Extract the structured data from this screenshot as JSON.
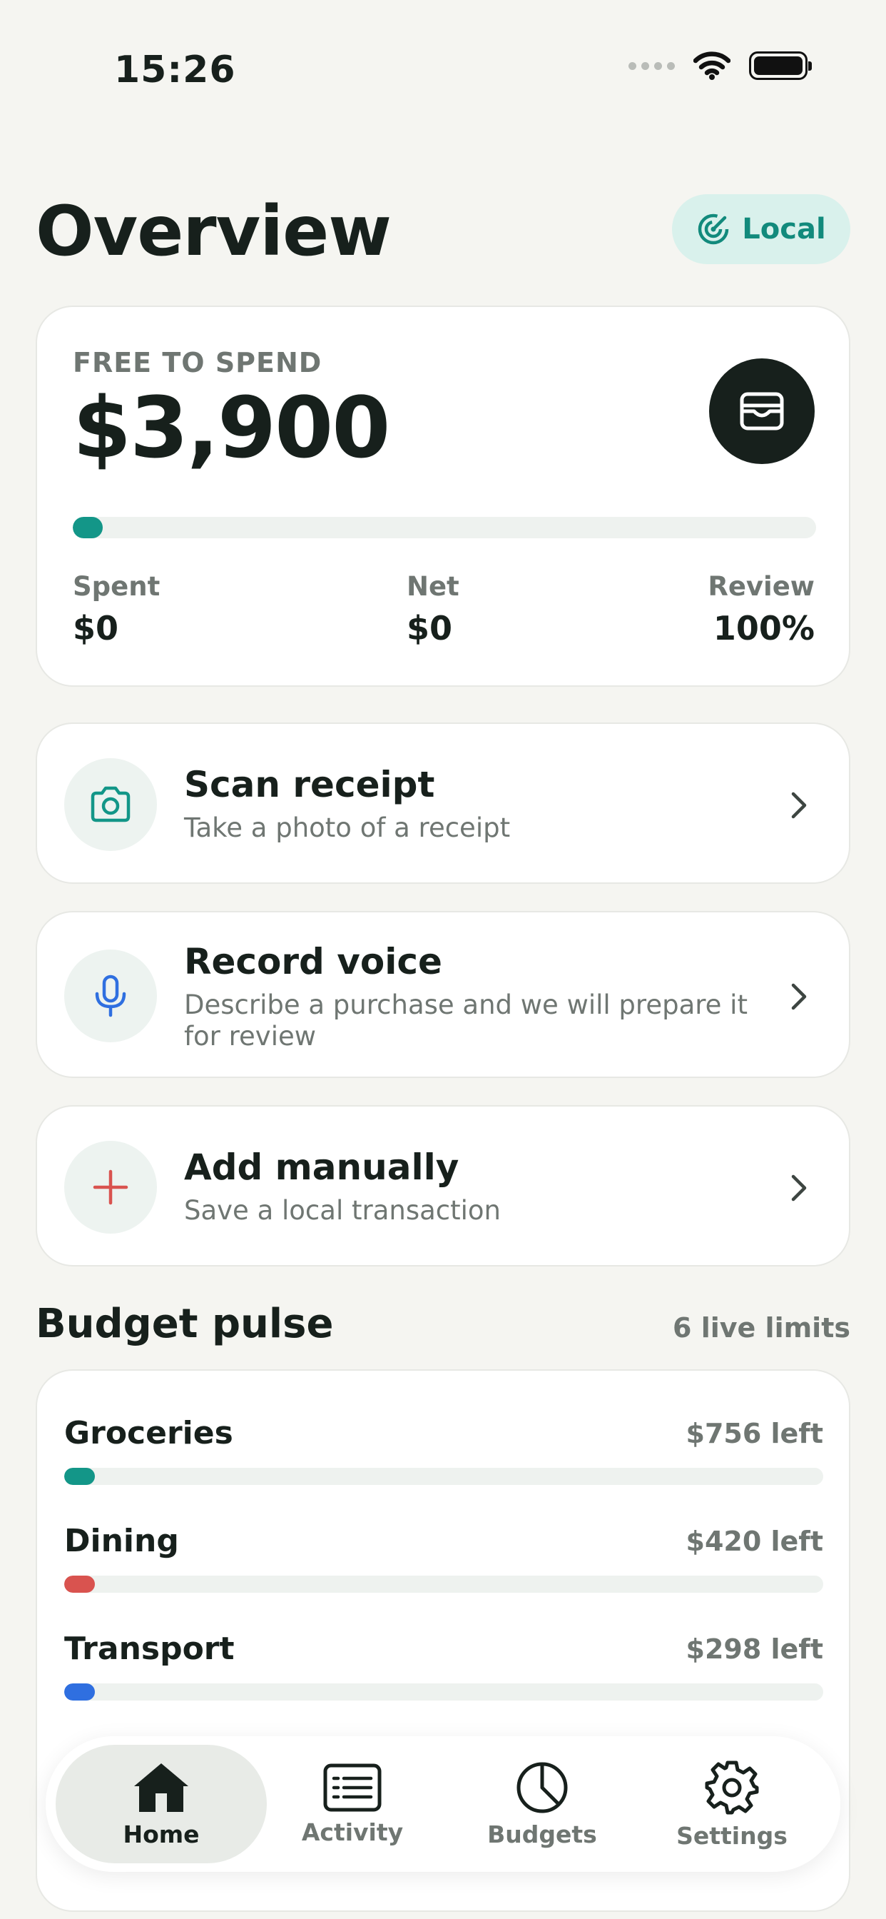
{
  "status_bar": {
    "time": "15:26"
  },
  "header": {
    "title": "Overview",
    "mode_label": "Local"
  },
  "summary": {
    "eyebrow": "FREE TO SPEND",
    "amount": "$3,900",
    "progress": 0.04,
    "stats": [
      {
        "label": "Spent",
        "value": "$0"
      },
      {
        "label": "Net",
        "value": "$0"
      },
      {
        "label": "Review",
        "value": "100%"
      }
    ]
  },
  "actions": [
    {
      "title": "Scan receipt",
      "subtitle": "Take a photo of a receipt",
      "icon": "camera-icon"
    },
    {
      "title": "Record voice",
      "subtitle": "Describe a purchase and we will prepare it for review",
      "icon": "microphone-icon"
    },
    {
      "title": "Add manually",
      "subtitle": "Save a local transaction",
      "icon": "plus-icon"
    }
  ],
  "budget_pulse": {
    "title": "Budget pulse",
    "meta": "6 live limits",
    "items": [
      {
        "name": "Groceries",
        "left": "$756 left",
        "color": "#139688",
        "progress": 0.04
      },
      {
        "name": "Dining",
        "left": "$420 left",
        "color": "#d9534f",
        "progress": 0.04
      },
      {
        "name": "Transport",
        "left": "$298 left",
        "color": "#2f6fe0",
        "progress": 0.04
      }
    ]
  },
  "tabs": [
    {
      "label": "Home",
      "icon": "home-icon",
      "active": true
    },
    {
      "label": "Activity",
      "icon": "list-icon",
      "active": false
    },
    {
      "label": "Budgets",
      "icon": "pie-chart-icon",
      "active": false
    },
    {
      "label": "Settings",
      "icon": "gear-icon",
      "active": false
    }
  ],
  "colors": {
    "accent": "#139688",
    "dark": "#17201c",
    "background": "#f5f5f1"
  }
}
